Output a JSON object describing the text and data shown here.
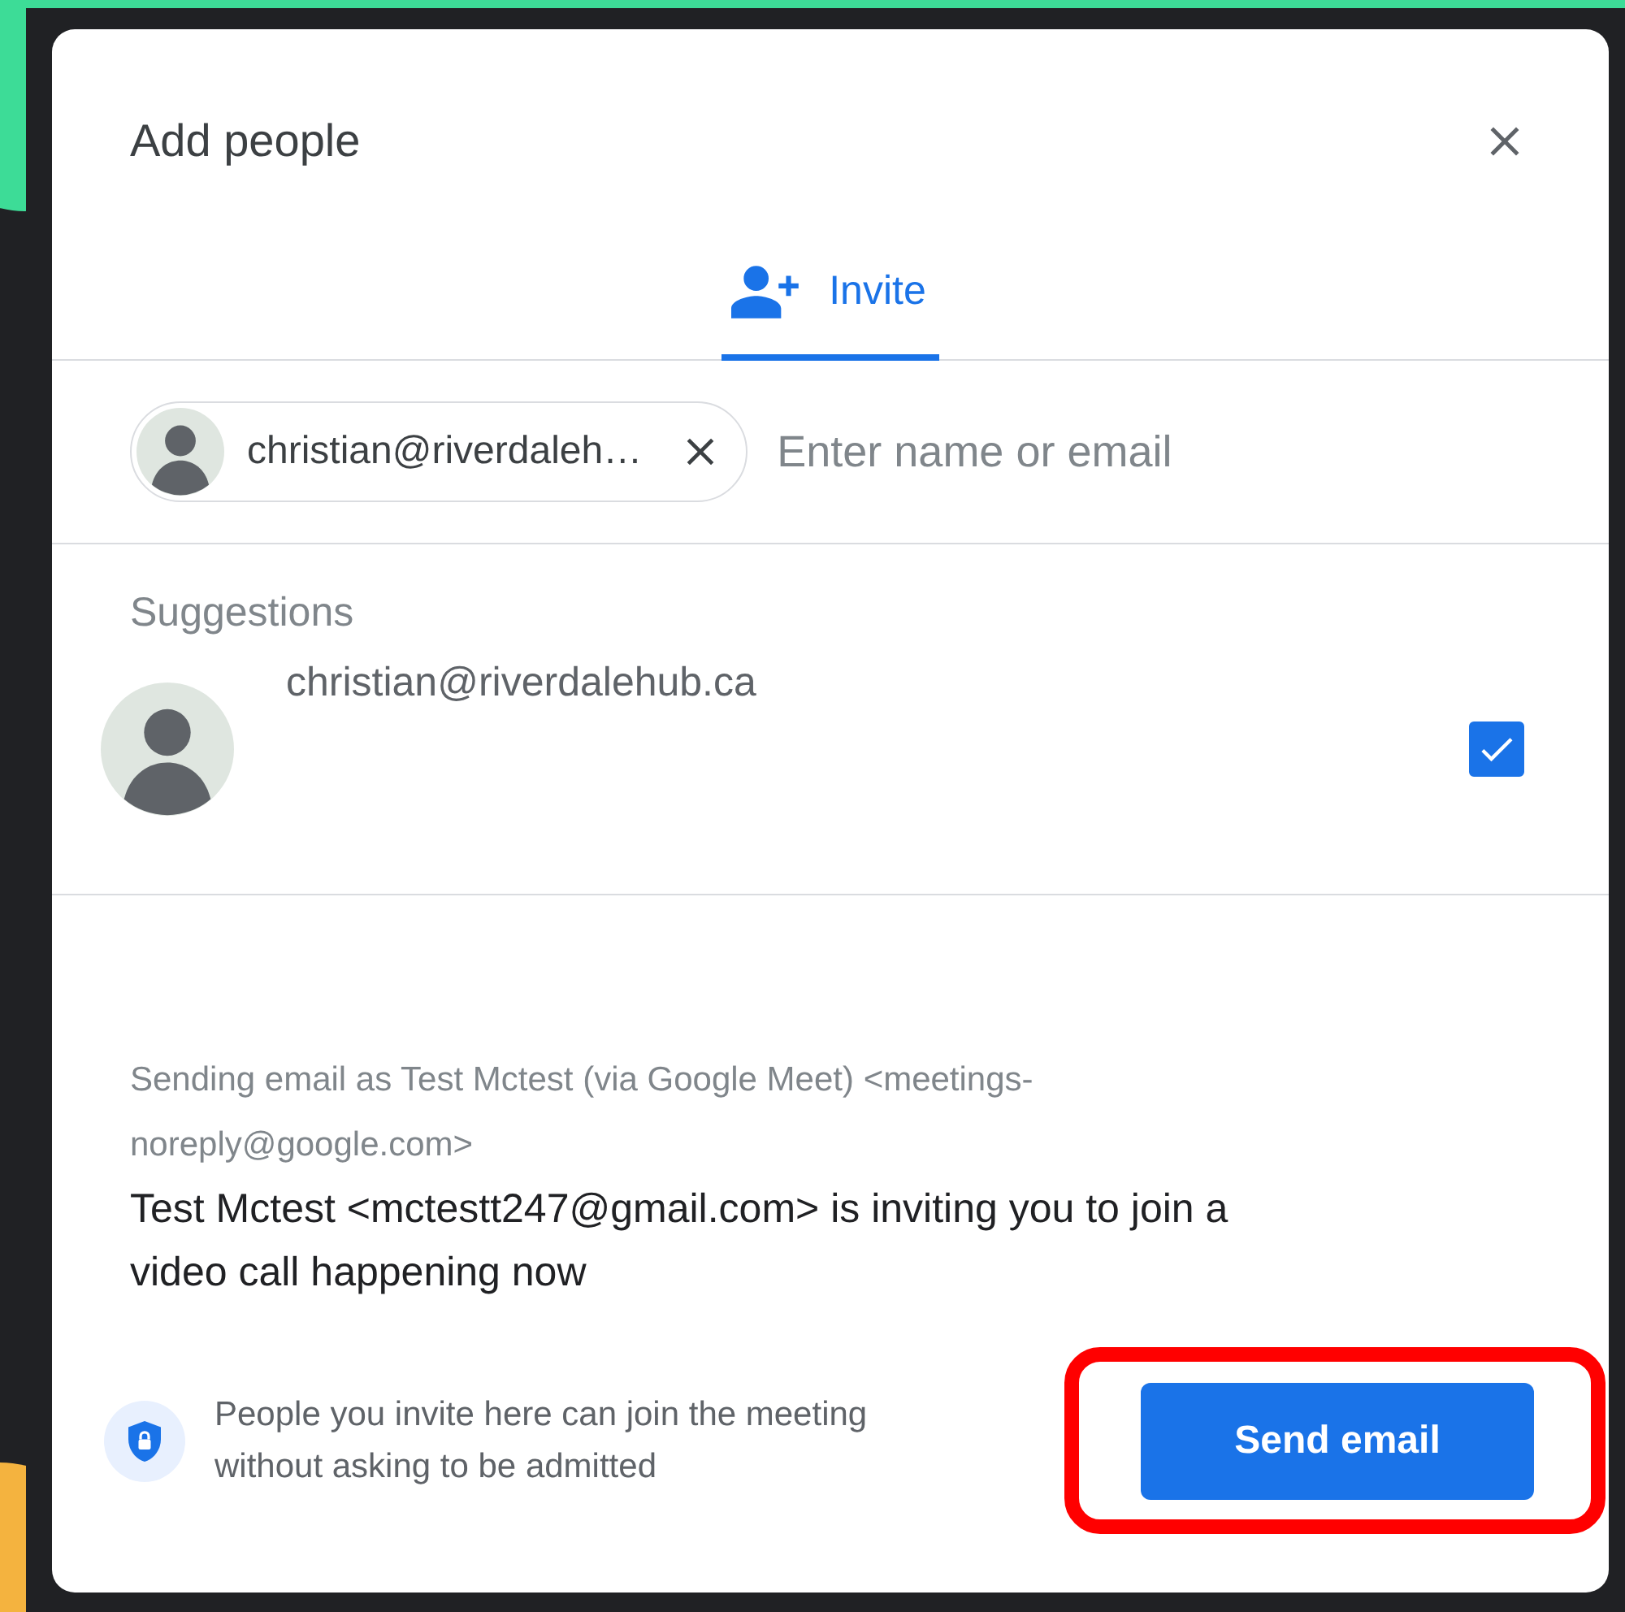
{
  "dialog": {
    "title": "Add people",
    "tabs": [
      {
        "label": "Invite",
        "selected": true
      }
    ],
    "recipient_chips": [
      {
        "label": "christian@riverdaleh…"
      }
    ],
    "input": {
      "placeholder": "Enter name or email"
    },
    "suggestions_heading": "Suggestions",
    "suggestions": [
      {
        "email": "christian@riverdalehub.ca",
        "checked": true
      }
    ],
    "sender_note": "Sending email as Test Mctest (via Google Meet) <meetings-noreply@google.com>",
    "invite_message": "Test Mctest <mctestt247@gmail.com> is inviting you to join a video call happening now",
    "security_note": "People you invite here can join the meeting without asking to be admitted",
    "send_button": "Send email"
  }
}
